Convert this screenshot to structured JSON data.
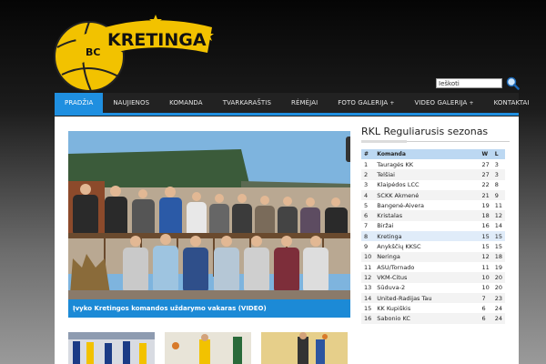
{
  "logo": {
    "prefix": "BC",
    "name": "KRETINGA"
  },
  "search": {
    "placeholder": "Ieškoti"
  },
  "nav": [
    {
      "label": "PRADŽIA",
      "active": true,
      "sub": false
    },
    {
      "label": "NAUJIENOS",
      "active": false,
      "sub": false
    },
    {
      "label": "KOMANDA",
      "active": false,
      "sub": false
    },
    {
      "label": "TVARKARAŠTIS",
      "active": false,
      "sub": false
    },
    {
      "label": "RĖMĖJAI",
      "active": false,
      "sub": false
    },
    {
      "label": "FOTO GALERIJA",
      "active": false,
      "sub": true
    },
    {
      "label": "VIDEO GALERIJA",
      "active": false,
      "sub": true
    },
    {
      "label": "KONTAKTAI",
      "active": false,
      "sub": false
    }
  ],
  "nav_plus": "+",
  "slider": {
    "caption": "Įvyko Kretingos komandos uždarymo vakaras (VIDEO)"
  },
  "standings": {
    "title": "RKL Reguliarusis sezonas",
    "headers": [
      "#",
      "Komanda",
      "W",
      "L"
    ],
    "rows": [
      {
        "pos": "1",
        "team": "Tauragės KK",
        "w": "27",
        "l": "3"
      },
      {
        "pos": "2",
        "team": "Telšiai",
        "w": "27",
        "l": "3"
      },
      {
        "pos": "3",
        "team": "Klaipėdos LCC",
        "w": "22",
        "l": "8"
      },
      {
        "pos": "4",
        "team": "SCKK Akmenė",
        "w": "21",
        "l": "9"
      },
      {
        "pos": "5",
        "team": "Bangenė-Aivera",
        "w": "19",
        "l": "11"
      },
      {
        "pos": "6",
        "team": "Kristalas",
        "w": "18",
        "l": "12"
      },
      {
        "pos": "7",
        "team": "Biržai",
        "w": "16",
        "l": "14"
      },
      {
        "pos": "8",
        "team": "Kretinga",
        "w": "15",
        "l": "15"
      },
      {
        "pos": "9",
        "team": "Anykščių KKSC",
        "w": "15",
        "l": "15"
      },
      {
        "pos": "10",
        "team": "Neringa",
        "w": "12",
        "l": "18"
      },
      {
        "pos": "11",
        "team": "ASU/Tornado",
        "w": "11",
        "l": "19"
      },
      {
        "pos": "12",
        "team": "VKM-Citus",
        "w": "10",
        "l": "20"
      },
      {
        "pos": "13",
        "team": "Sūduva-2",
        "w": "10",
        "l": "20"
      },
      {
        "pos": "14",
        "team": "United-Radijas Tau",
        "w": "7",
        "l": "23"
      },
      {
        "pos": "15",
        "team": "KK Kupiškis",
        "w": "6",
        "l": "24"
      },
      {
        "pos": "16",
        "team": "Sabonio KC",
        "w": "6",
        "l": "24"
      }
    ]
  },
  "colors": {
    "accent": "#1f8fe0",
    "nav_bg": "#222222",
    "logo_yellow": "#f2c200"
  }
}
